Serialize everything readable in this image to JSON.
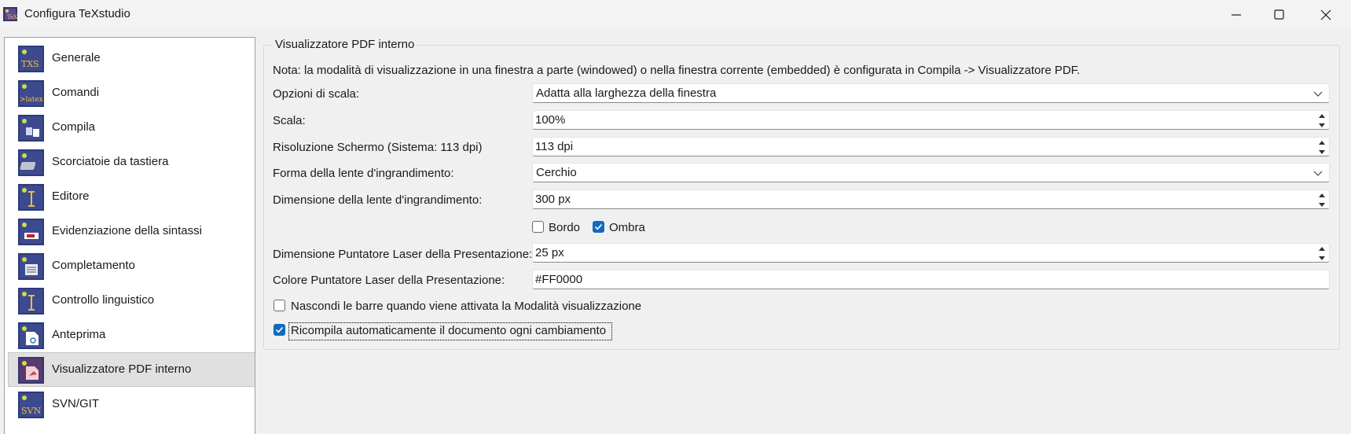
{
  "window": {
    "title": "Configura TeXstudio",
    "app_icon": "texstudio-icon"
  },
  "sidebar": {
    "items": [
      {
        "label": "Generale",
        "icon": "txs-icon",
        "selected": false
      },
      {
        "label": "Comandi",
        "icon": "latex-icon",
        "selected": false
      },
      {
        "label": "Compila",
        "icon": "build-icon",
        "selected": false
      },
      {
        "label": "Scorciatoie da tastiera",
        "icon": "keyboard-icon",
        "selected": false
      },
      {
        "label": "Editore",
        "icon": "text-cursor-icon",
        "selected": false
      },
      {
        "label": "Evidenziazione della sintassi",
        "icon": "highlight-icon",
        "selected": false
      },
      {
        "label": "Completamento",
        "icon": "completion-icon",
        "selected": false
      },
      {
        "label": "Controllo linguistico",
        "icon": "spellcheck-icon",
        "selected": false
      },
      {
        "label": "Anteprima",
        "icon": "preview-icon",
        "selected": false
      },
      {
        "label": "Visualizzatore PDF interno",
        "icon": "pdf-viewer-icon",
        "selected": true
      },
      {
        "label": "SVN/GIT",
        "icon": "svn-icon",
        "selected": false
      }
    ]
  },
  "panel": {
    "group_title": "Visualizzatore PDF interno",
    "note": "Nota: la modalità di visualizzazione in una finestra a parte (windowed) o nella finestra corrente (embedded) è configurata in Compila -> Visualizzatore PDF.",
    "scale_options": {
      "label": "Opzioni di scala:",
      "value": "Adatta alla larghezza della finestra"
    },
    "scale": {
      "label": "Scala:",
      "value": "100%"
    },
    "resolution": {
      "label": "Risoluzione Schermo (Sistema: 113 dpi)",
      "value": "113 dpi"
    },
    "magnifier_shape": {
      "label": "Forma della lente d'ingrandimento:",
      "value": "Cerchio"
    },
    "magnifier_size": {
      "label": "Dimensione della lente d'ingrandimento:",
      "value": "300 px"
    },
    "border_checkbox": {
      "label": "Bordo",
      "checked": false
    },
    "shadow_checkbox": {
      "label": "Ombra",
      "checked": true
    },
    "laser_size": {
      "label": "Dimensione Puntatore Laser della Presentazione:",
      "value": "25 px"
    },
    "laser_color": {
      "label": "Colore Puntatore Laser della Presentazione:",
      "value": "#FF0000"
    },
    "hide_bars_checkbox": {
      "label": "Nascondi le barre quando viene attivata la Modalità visualizzazione",
      "checked": false
    },
    "auto_recompile_checkbox": {
      "label": "Ricompila automaticamente il documento ogni cambiamento",
      "checked": true
    }
  },
  "colors": {
    "accent": "#0f6cbd",
    "selected_item": "#e0e0e0",
    "icon_bg": "#2c3a78"
  }
}
